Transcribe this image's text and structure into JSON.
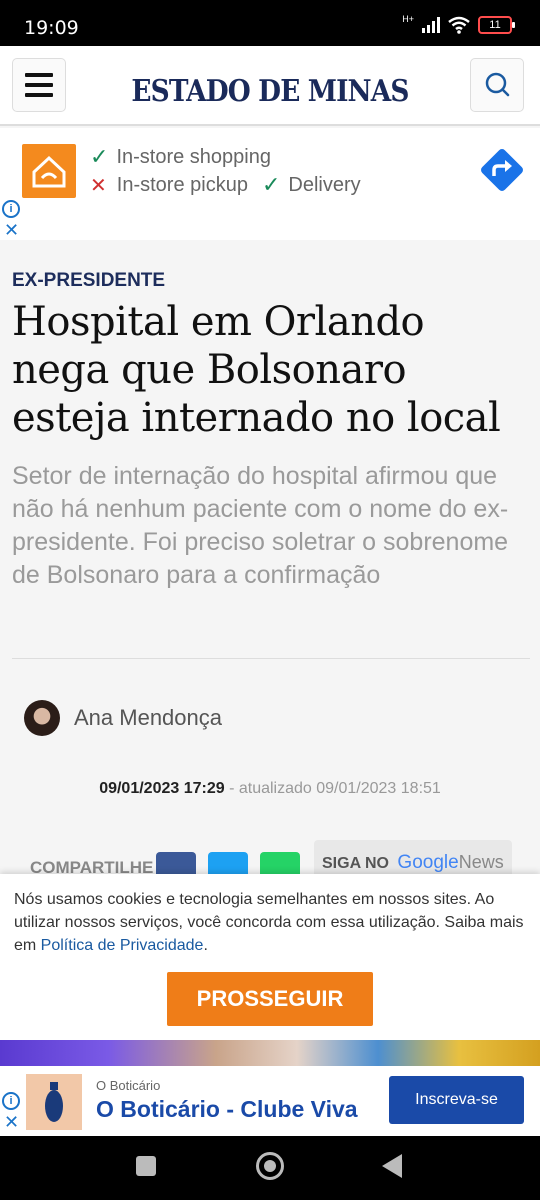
{
  "status_bar": {
    "time": "19:09",
    "network": "H+",
    "battery": "11"
  },
  "header": {
    "logo": "ESTADO DE MINAS"
  },
  "top_ad": {
    "line1": "In-store shopping",
    "line2a": "In-store pickup",
    "line2b": "Delivery",
    "info_glyph": "i",
    "close_glyph": "✕"
  },
  "article": {
    "kicker": "EX-PRESIDENTE",
    "headline": "Hospital em Orlando nega que Bolsonaro esteja internado no local",
    "subtitle": "Setor de internação do hospital afirmou que não há nenhum paciente com o nome do ex-presidente. Foi preciso soletrar o sobrenome de Bolsonaro para a confirmação",
    "author": "Ana Mendonça",
    "published": "09/01/2023 17:29",
    "updated": " - atualizado 09/01/2023 18:51"
  },
  "share": {
    "label": "COMPARTILHE",
    "siga_no": "SIGA NO",
    "google": "Google",
    "news": "News"
  },
  "cookie_banner": {
    "text": "Nós usamos cookies e tecnologia semelhantes em nossos sites. Ao utilizar nossos serviços, você concorda com essa utilização. Saiba mais em ",
    "link": "Política de Privacidade",
    "text_end": ".",
    "button": "PROSSEGUIR"
  },
  "bottom_ad": {
    "brand": "O Boticário",
    "title": "O Boticário - Clube Viva",
    "button": "Inscreva-se",
    "info_glyph": "i",
    "close_glyph": "✕"
  },
  "colors": {
    "logo": "#1a2a5a",
    "cookie_button": "#ef7d18",
    "ad_button": "#1a4aa8"
  }
}
